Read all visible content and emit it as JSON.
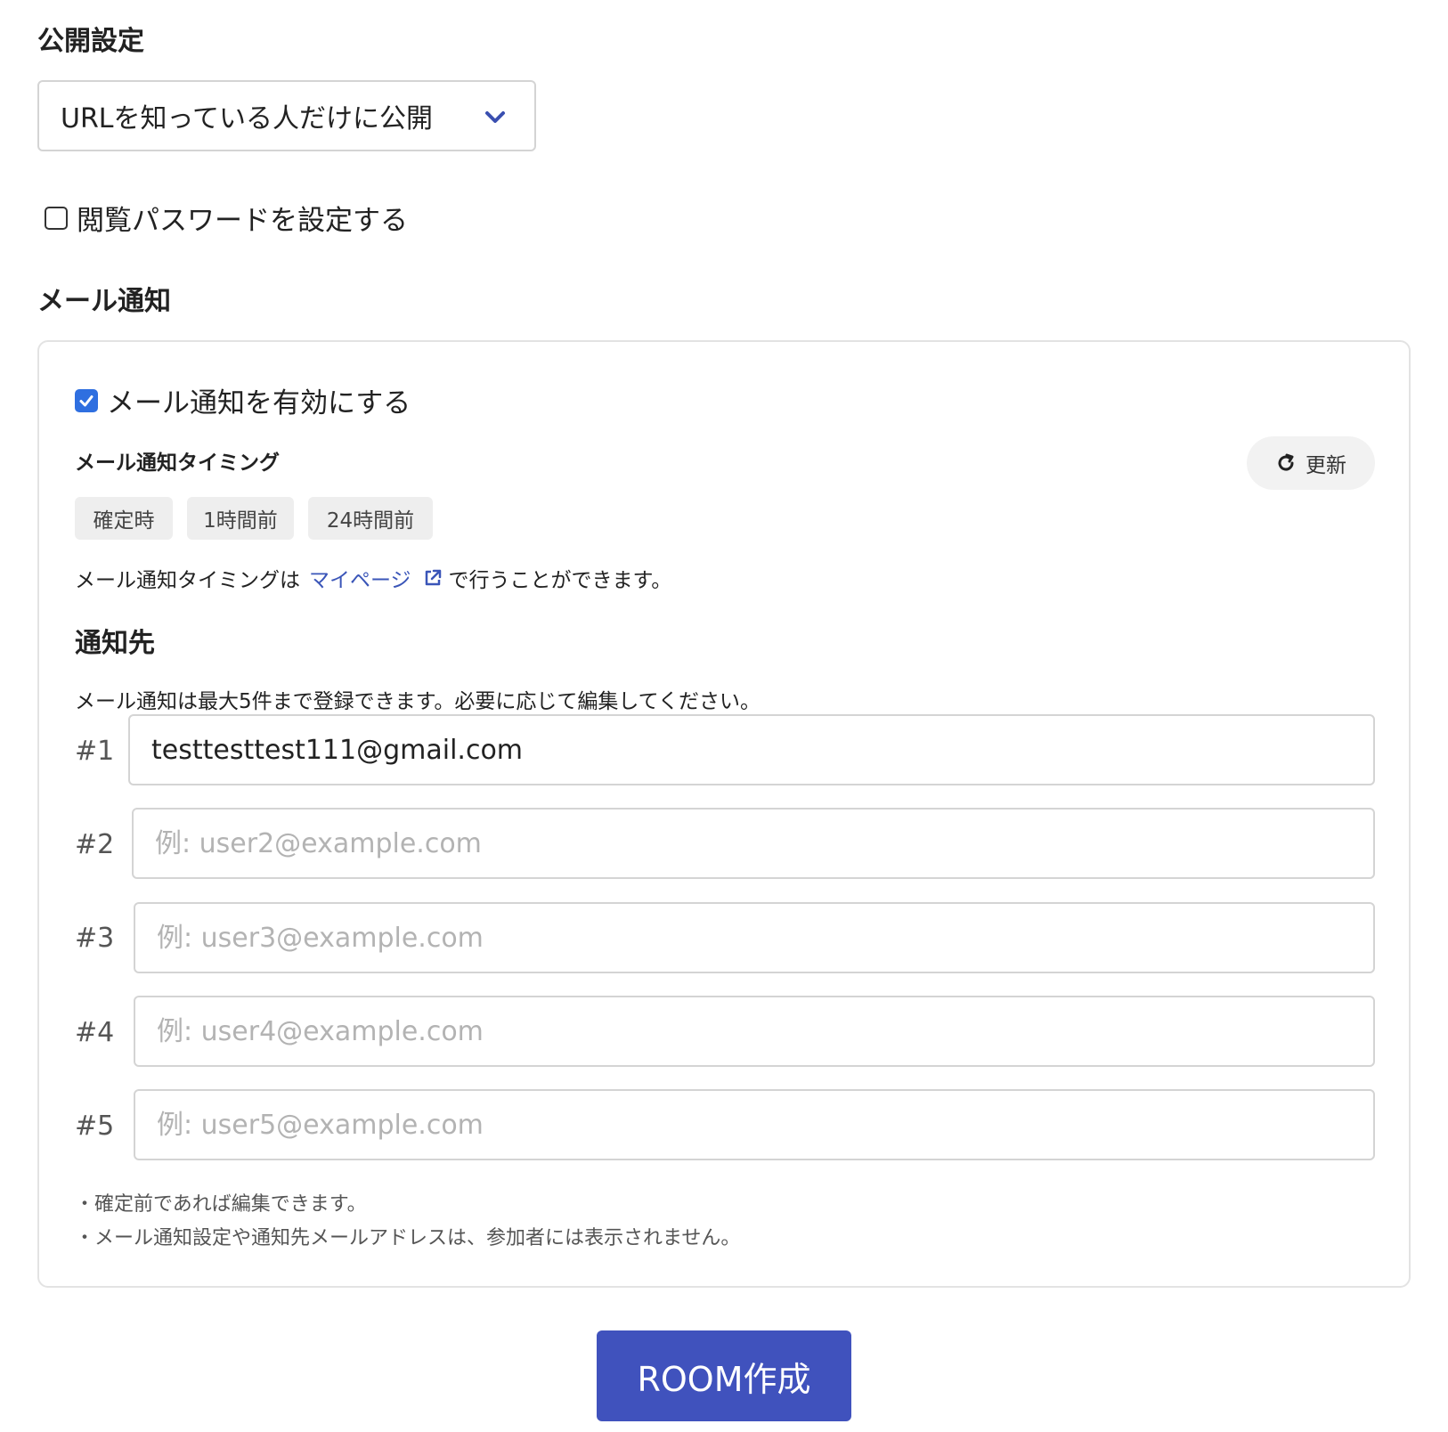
{
  "visibility": {
    "title": "公開設定",
    "selected": "URLを知っている人だけに公開"
  },
  "password": {
    "label": "閲覧パスワードを設定する",
    "checked": false
  },
  "mail": {
    "title": "メール通知",
    "enable_label": "メール通知を有効にする",
    "enabled": true,
    "timing_title": "メール通知タイミング",
    "refresh_label": "更新",
    "chips": [
      "確定時",
      "1時間前",
      "24時間前"
    ],
    "timing_note_prefix": "メール通知タイミングは",
    "timing_note_link": "マイページ",
    "timing_note_suffix": "で行うことができます。",
    "dest_title": "通知先",
    "dest_desc": "メール通知は最大5件まで登録できます。必要に応じて編集してください。",
    "recipients": [
      {
        "label": "#1",
        "value": "testtesttest111@gmail.com",
        "placeholder": ""
      },
      {
        "label": "#2",
        "value": "",
        "placeholder": "例: user2@example.com"
      },
      {
        "label": "#3",
        "value": "",
        "placeholder": "例: user3@example.com"
      },
      {
        "label": "#4",
        "value": "",
        "placeholder": "例: user4@example.com"
      },
      {
        "label": "#5",
        "value": "",
        "placeholder": "例: user5@example.com"
      }
    ],
    "notes": [
      "・確定前であれば編集できます。",
      "・メール通知設定や通知先メールアドレスは、参加者には表示されません。"
    ]
  },
  "submit_label": "ROOM作成",
  "colors": {
    "primary": "#4052bd",
    "link": "#3a55b8",
    "checkbox": "#2f6fe0"
  }
}
